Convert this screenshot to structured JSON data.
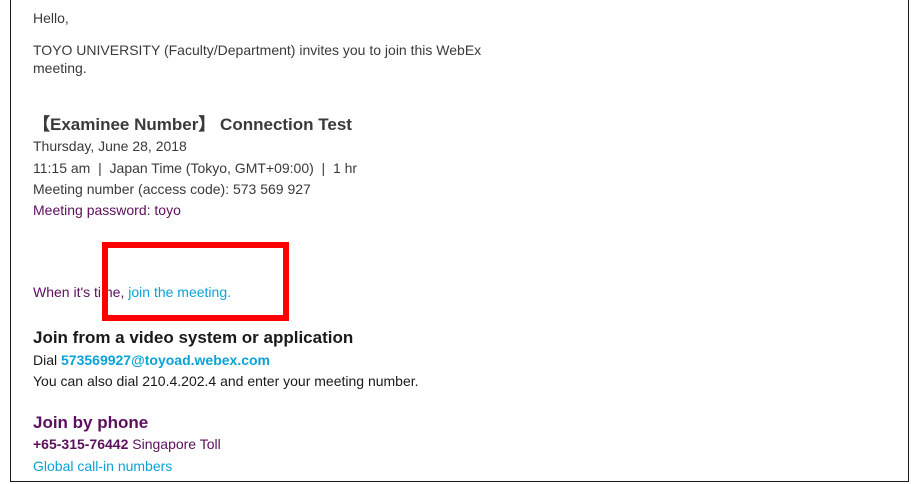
{
  "greeting": "Hello,",
  "invite_line1": "TOYO UNIVERSITY (Faculty/Department) invites you to join this WebEx",
  "invite_line2": "meeting.",
  "meeting": {
    "title": "【Examinee Number】 Connection Test",
    "date": "Thursday, June 28, 2018",
    "time": "11:15 am  |  Japan Time (Tokyo, GMT+09:00)  |  1 hr",
    "number": "Meeting number (access code): 573 569 927",
    "password": "Meeting password: toyo"
  },
  "join": {
    "prefix": "When it's time, ",
    "link": "join the meeting",
    "suffix": "."
  },
  "video_system": {
    "heading": "Join from a video system or application",
    "dial_label": "Dial ",
    "dial_address": "573569927@toyoad.webex.com",
    "also": "You can also dial 210.4.202.4 and enter your meeting number."
  },
  "phone": {
    "heading": "Join by phone",
    "number": "+65-315-76442",
    "toll": " Singapore Toll",
    "global_link": "Global call-in numbers"
  },
  "highlight_color": "#ff0000"
}
